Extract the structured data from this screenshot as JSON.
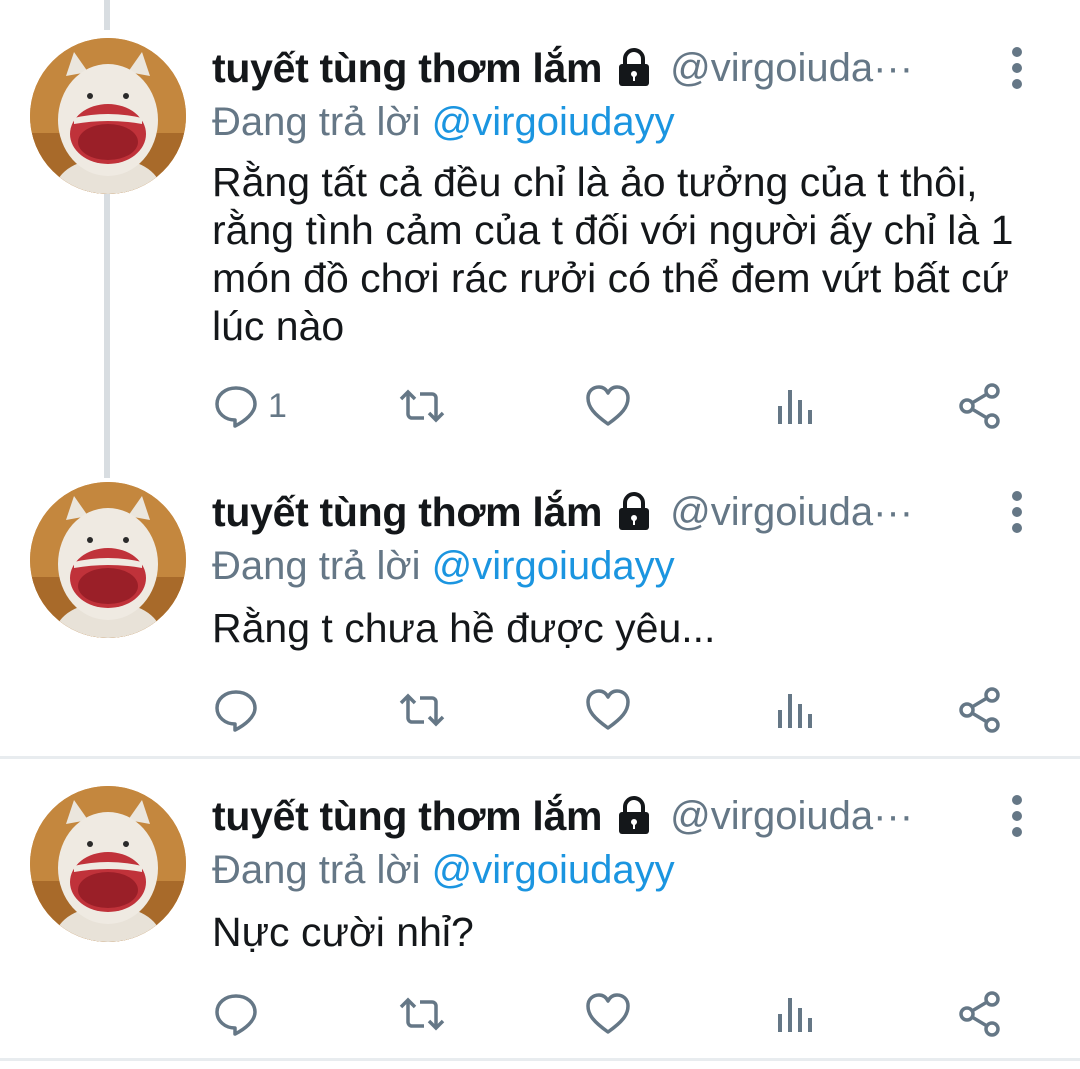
{
  "colors": {
    "name": "#14171a",
    "muted": "#657786",
    "link": "#1b95e0",
    "line": "#d8dde1"
  },
  "tweets": [
    {
      "name": "tuyết tùng thơm lắm",
      "handle": "@virgoiuda···",
      "reply_prefix": "Đang trả lời ",
      "reply_mention": "@virgoiudayy",
      "text": "Rằng tất cả đều chỉ là ảo tưởng của t thôi, rằng tình cảm của t đối với người ấy chỉ là 1 món đồ chơi rác rưởi có thể đem vứt bất cứ lúc nào",
      "reply_count": "1",
      "icons": [
        "reply-icon",
        "retweet-icon",
        "like-icon",
        "analytics-icon",
        "share-icon"
      ]
    },
    {
      "name": "tuyết tùng thơm lắm",
      "handle": "@virgoiuda···",
      "reply_prefix": "Đang trả lời ",
      "reply_mention": "@virgoiudayy",
      "text": "Rằng t chưa hề được yêu...",
      "reply_count": ""
    },
    {
      "name": "tuyết tùng thơm lắm",
      "handle": "@virgoiuda···",
      "reply_prefix": "Đang trả lời ",
      "reply_mention": "@virgoiudayy",
      "text": "Nực cười nhỉ?",
      "reply_count": ""
    }
  ]
}
